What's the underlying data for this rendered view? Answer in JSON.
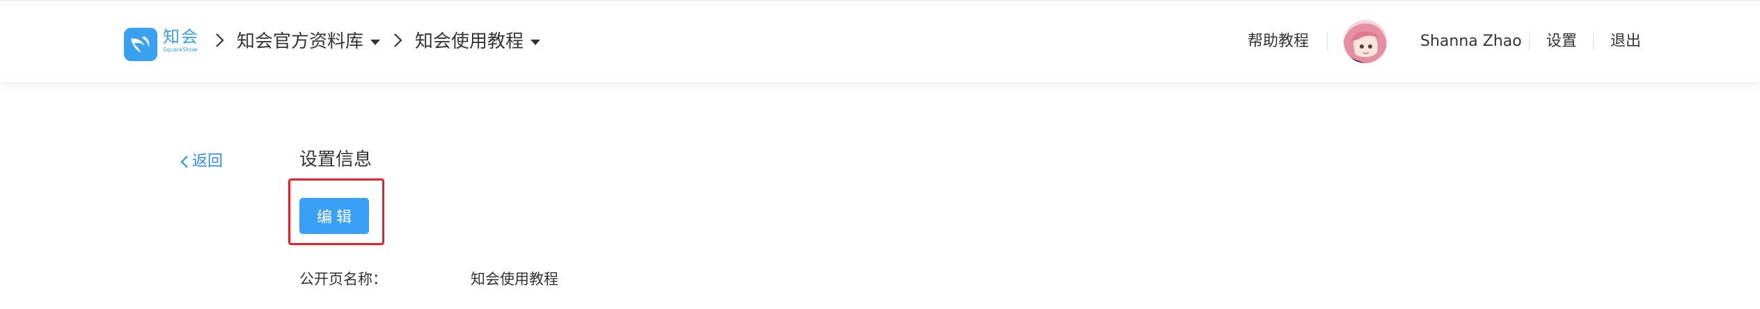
{
  "header": {
    "logo_cn": "知会",
    "logo_en": "SquareShow",
    "breadcrumb": [
      {
        "label": "知会官方资料库"
      },
      {
        "label": "知会使用教程"
      }
    ],
    "help_label": "帮助教程",
    "user_name": "Shanna Zhao",
    "settings_label": "设置",
    "logout_label": "退出"
  },
  "main": {
    "back_label": "返回",
    "section_title": "设置信息",
    "edit_button_label": "编辑",
    "fields": [
      {
        "label": "公开页名称：",
        "value": "知会使用教程"
      }
    ]
  },
  "colors": {
    "accent": "#3aa0f5",
    "link": "#2d8cf0",
    "highlight_frame": "#e8202a"
  },
  "icons": [
    "logo-icon",
    "chevron-right-icon",
    "caret-down-icon",
    "chevron-left-icon",
    "avatar"
  ]
}
